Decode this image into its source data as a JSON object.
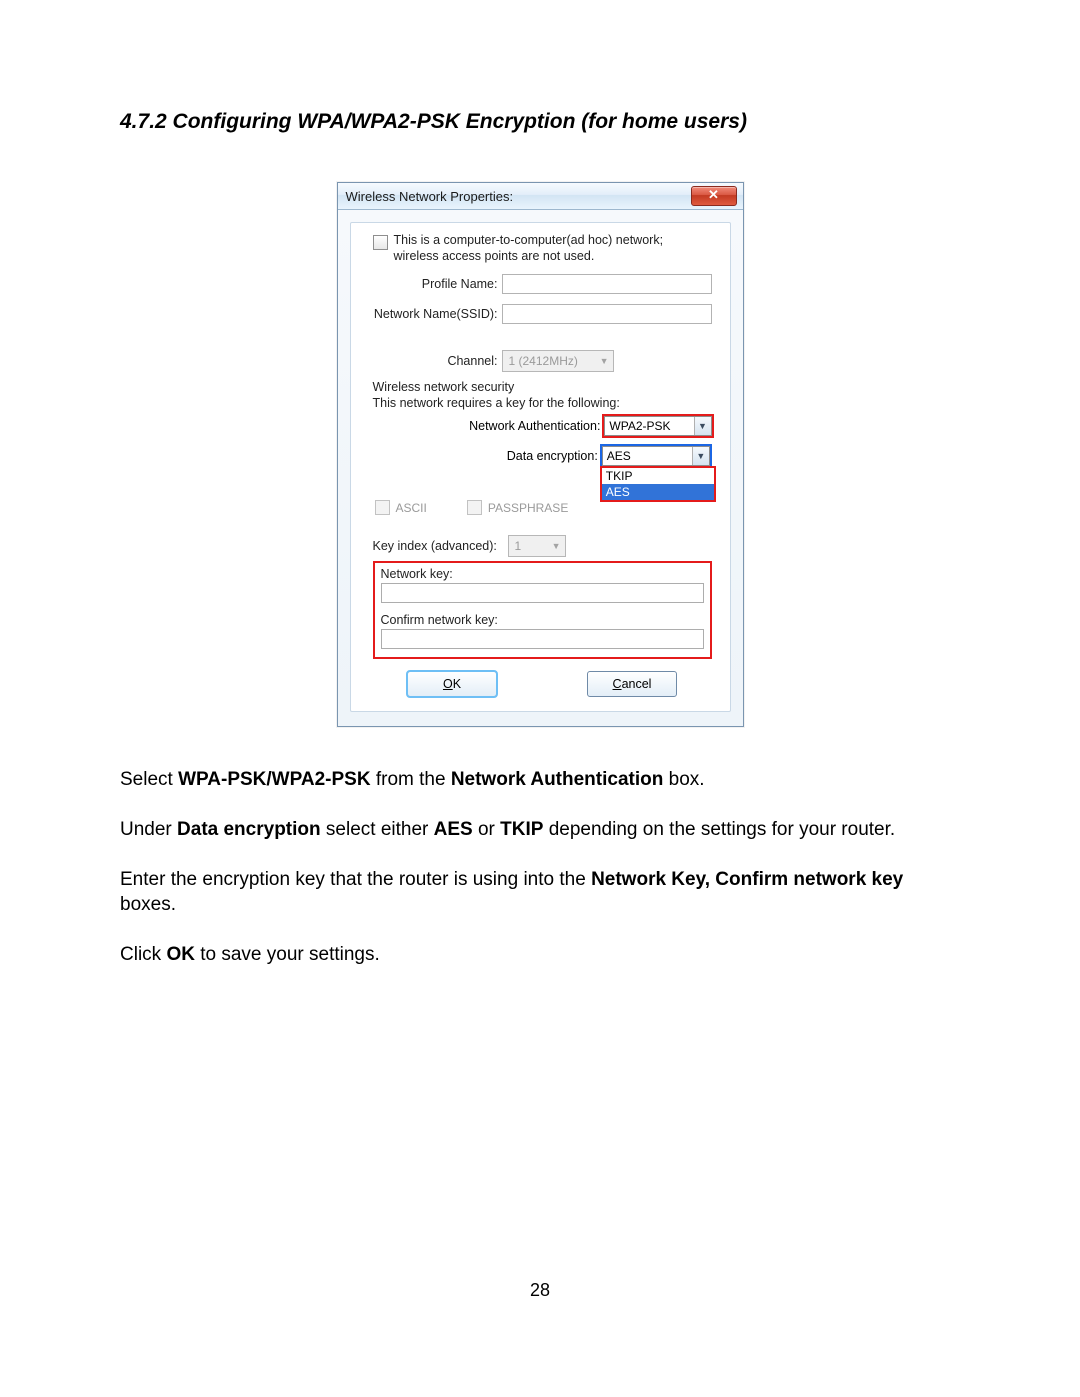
{
  "heading": "4.7.2 Configuring WPA/WPA2-PSK Encryption (for home users)",
  "dialog": {
    "title": "Wireless Network Properties:",
    "close_glyph": "✕",
    "adhoc_text": "This is a computer-to-computer(ad hoc) network; wireless access points are not used.",
    "profile_label": "Profile Name:",
    "ssid_label": "Network Name(SSID):",
    "channel_label": "Channel:",
    "channel_value": "1 (2412MHz)",
    "security_section": "Wireless network security",
    "security_note": "This network requires a key for the following:",
    "auth_label": "Network Authentication:",
    "auth_value": "WPA2-PSK",
    "enc_label": "Data encryption:",
    "enc_value": "AES",
    "enc_options": [
      "TKIP",
      "AES"
    ],
    "ascii_label": "ASCII",
    "passphrase_label": "PASSPHRASE",
    "keyindex_label": "Key index (advanced):",
    "keyindex_value": "1",
    "netkey_label": "Network key:",
    "confirmkey_label": "Confirm network key:",
    "ok_label": "OK",
    "cancel_label": "Cancel"
  },
  "para1_pre": "Select ",
  "para1_b1": "WPA-PSK/WPA2-PSK",
  "para1_mid": " from the ",
  "para1_b2": "Network Authentication",
  "para1_post": " box.",
  "para2_pre": "Under ",
  "para2_b1": "Data encryption",
  "para2_mid1": " select either ",
  "para2_b2": "AES",
  "para2_mid2": " or ",
  "para2_b3": "TKIP",
  "para2_post": " depending on the settings for your router.",
  "para3_pre": "Enter the encryption key that the router is using into the ",
  "para3_b1": "Network Key, Confirm network key",
  "para3_post": " boxes.",
  "para4_pre": "Click ",
  "para4_b1": "OK",
  "para4_post": " to save your settings.",
  "page_number": "28"
}
